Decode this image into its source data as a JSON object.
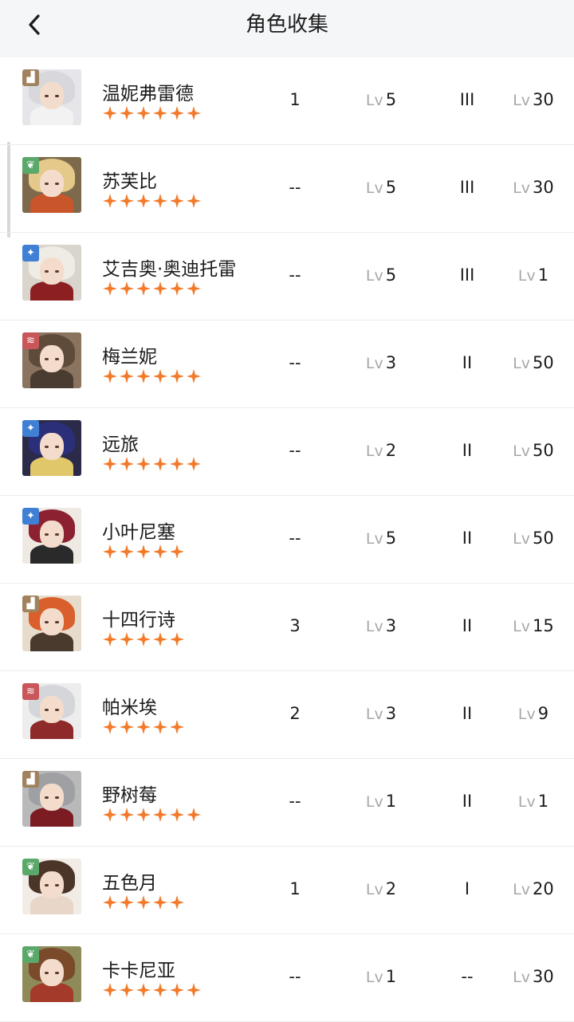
{
  "header": {
    "title": "角色收集"
  },
  "colors": {
    "star": "#f27a2a",
    "badge_earth": "#a0835e",
    "badge_grass": "#5aa86a",
    "badge_star": "#3f7fd4",
    "badge_beast": "#c9575a"
  },
  "characters": [
    {
      "name": "温妮弗雷德",
      "stars": 6,
      "element": "earth",
      "c1": "1",
      "lv": "5",
      "tier": "III",
      "lv2": "30",
      "look": {
        "bg": "#e6e6ea",
        "hair": "#d8d8dc",
        "body": "#f2f2f2"
      }
    },
    {
      "name": "苏芙比",
      "stars": 6,
      "element": "grass",
      "c1": "--",
      "lv": "5",
      "tier": "III",
      "lv2": "30",
      "look": {
        "bg": "#7d6a4c",
        "hair": "#e4c98a",
        "body": "#c9562b"
      }
    },
    {
      "name": "艾吉奥·奥迪托雷",
      "stars": 6,
      "element": "star",
      "c1": "--",
      "lv": "5",
      "tier": "III",
      "lv2": "1",
      "look": {
        "bg": "#d9d4cc",
        "hair": "#efece6",
        "body": "#8c1f22"
      }
    },
    {
      "name": "梅兰妮",
      "stars": 6,
      "element": "beast",
      "c1": "--",
      "lv": "3",
      "tier": "II",
      "lv2": "50",
      "look": {
        "bg": "#8a7460",
        "hair": "#5e4b3a",
        "body": "#4a3c30"
      }
    },
    {
      "name": "远旅",
      "stars": 6,
      "element": "star",
      "c1": "--",
      "lv": "2",
      "tier": "II",
      "lv2": "50",
      "look": {
        "bg": "#2b2a48",
        "hair": "#2b2f7a",
        "body": "#e0c86a"
      }
    },
    {
      "name": "小叶尼塞",
      "stars": 5,
      "element": "star",
      "c1": "--",
      "lv": "5",
      "tier": "II",
      "lv2": "50",
      "look": {
        "bg": "#efe9e4",
        "hair": "#8c2231",
        "body": "#2a2a2a"
      }
    },
    {
      "name": "十四行诗",
      "stars": 5,
      "element": "earth",
      "c1": "3",
      "lv": "3",
      "tier": "II",
      "lv2": "15",
      "look": {
        "bg": "#e7dccc",
        "hair": "#d9602d",
        "body": "#4a3a2e"
      }
    },
    {
      "name": "帕米埃",
      "stars": 5,
      "element": "beast",
      "c1": "2",
      "lv": "3",
      "tier": "II",
      "lv2": "9",
      "look": {
        "bg": "#ededed",
        "hair": "#d5d6da",
        "body": "#8e2a2a"
      }
    },
    {
      "name": "野树莓",
      "stars": 6,
      "element": "earth",
      "c1": "--",
      "lv": "1",
      "tier": "II",
      "lv2": "1",
      "look": {
        "bg": "#b9b9b9",
        "hair": "#9ea0a3",
        "body": "#7a1c22"
      }
    },
    {
      "name": "五色月",
      "stars": 5,
      "element": "grass",
      "c1": "1",
      "lv": "2",
      "tier": "I",
      "lv2": "20",
      "look": {
        "bg": "#f2ece6",
        "hair": "#4b3428",
        "body": "#e8d7c8"
      }
    },
    {
      "name": "卡卡尼亚",
      "stars": 6,
      "element": "grass",
      "c1": "--",
      "lv": "1",
      "tier": "--",
      "lv2": "30",
      "look": {
        "bg": "#8f8a5a",
        "hair": "#7a4a2a",
        "body": "#a33a2a"
      }
    }
  ],
  "lv_prefix": "Lv"
}
